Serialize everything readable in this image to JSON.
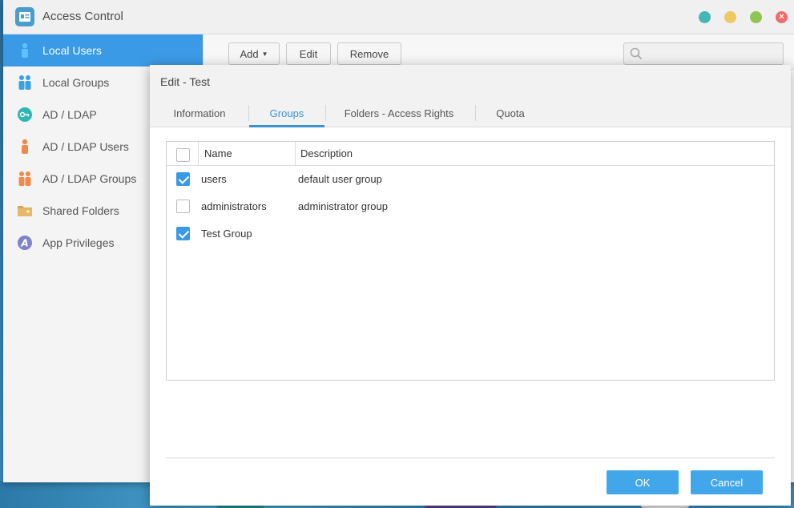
{
  "window": {
    "title": "Access Control"
  },
  "sidebar": {
    "items": [
      {
        "label": "Local Users",
        "icon": "user-icon",
        "active": true
      },
      {
        "label": "Local Groups",
        "icon": "group-icon"
      },
      {
        "label": "AD / LDAP",
        "icon": "key-icon"
      },
      {
        "label": "AD / LDAP Users",
        "icon": "user-icon"
      },
      {
        "label": "AD / LDAP Groups",
        "icon": "group-icon"
      },
      {
        "label": "Shared Folders",
        "icon": "folder-icon"
      },
      {
        "label": "App Privileges",
        "icon": "app-privileges-icon"
      }
    ]
  },
  "toolbar": {
    "add_label": "Add",
    "edit_label": "Edit",
    "remove_label": "Remove",
    "search_placeholder": ""
  },
  "dialog": {
    "title": "Edit - Test",
    "tabs": [
      "Information",
      "Groups",
      "Folders - Access Rights",
      "Quota"
    ],
    "active_tab": "Groups",
    "columns": {
      "name": "Name",
      "description": "Description"
    },
    "rows": [
      {
        "name": "users",
        "description": "default user group",
        "checked": true
      },
      {
        "name": "administrators",
        "description": "administrator group",
        "checked": false
      },
      {
        "name": "Test Group",
        "description": "",
        "checked": true
      }
    ],
    "ok_label": "OK",
    "cancel_label": "Cancel"
  },
  "colors": {
    "accent": "#3b9ae6",
    "button": "#42a7ea",
    "close": "#ef6a6a",
    "minimize": "#f0c862",
    "maximize": "#8fc553",
    "restore": "#45b6b6"
  }
}
